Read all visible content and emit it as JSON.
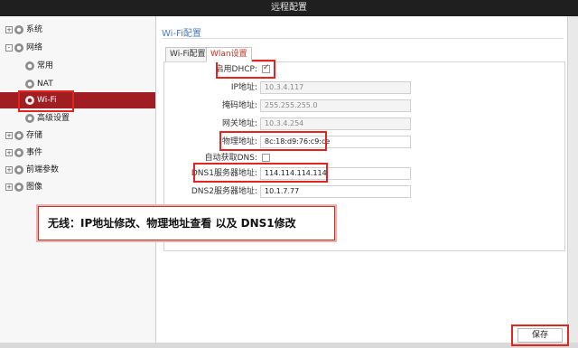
{
  "window": {
    "title": "远程配置"
  },
  "sidebar": {
    "items": [
      {
        "label": "系统",
        "expander": "+"
      },
      {
        "label": "网络",
        "expander": "-"
      },
      {
        "label": "常用"
      },
      {
        "label": "NAT"
      },
      {
        "label": "Wi-Fi"
      },
      {
        "label": "高级设置"
      },
      {
        "label": "存储",
        "expander": "+"
      },
      {
        "label": "事件",
        "expander": "+"
      },
      {
        "label": "前端参数",
        "expander": "+"
      },
      {
        "label": "图像",
        "expander": "+"
      }
    ]
  },
  "main": {
    "section_title": "Wi-Fi配置",
    "tabs": [
      {
        "label": "Wi-Fi配置"
      },
      {
        "label": "Wlan设置"
      }
    ],
    "fields": {
      "dhcp": {
        "label": "启用DHCP:",
        "checked": true
      },
      "ip": {
        "label": "IP地址:",
        "value": "10.3.4.117"
      },
      "mask": {
        "label": "掩码地址:",
        "value": "255.255.255.0"
      },
      "gateway": {
        "label": "网关地址:",
        "value": "10.3.4.254"
      },
      "mac": {
        "label": "物理地址:",
        "value": "8c:18:d9:76:c9:ce"
      },
      "auto_dns": {
        "label": "自动获取DNS:",
        "checked": false
      },
      "dns1": {
        "label": "DNS1服务器地址:",
        "value": "114.114.114.114"
      },
      "dns2": {
        "label": "DNS2服务器地址:",
        "value": "10.1.7.77"
      }
    },
    "annotation": "无线：IP地址修改、物理地址查看 以及 DNS1修改",
    "save_label": "保存"
  },
  "colors": {
    "accent": "#a01d22",
    "highlight": "#e2261f",
    "title_blue": "#4f7fbf"
  }
}
